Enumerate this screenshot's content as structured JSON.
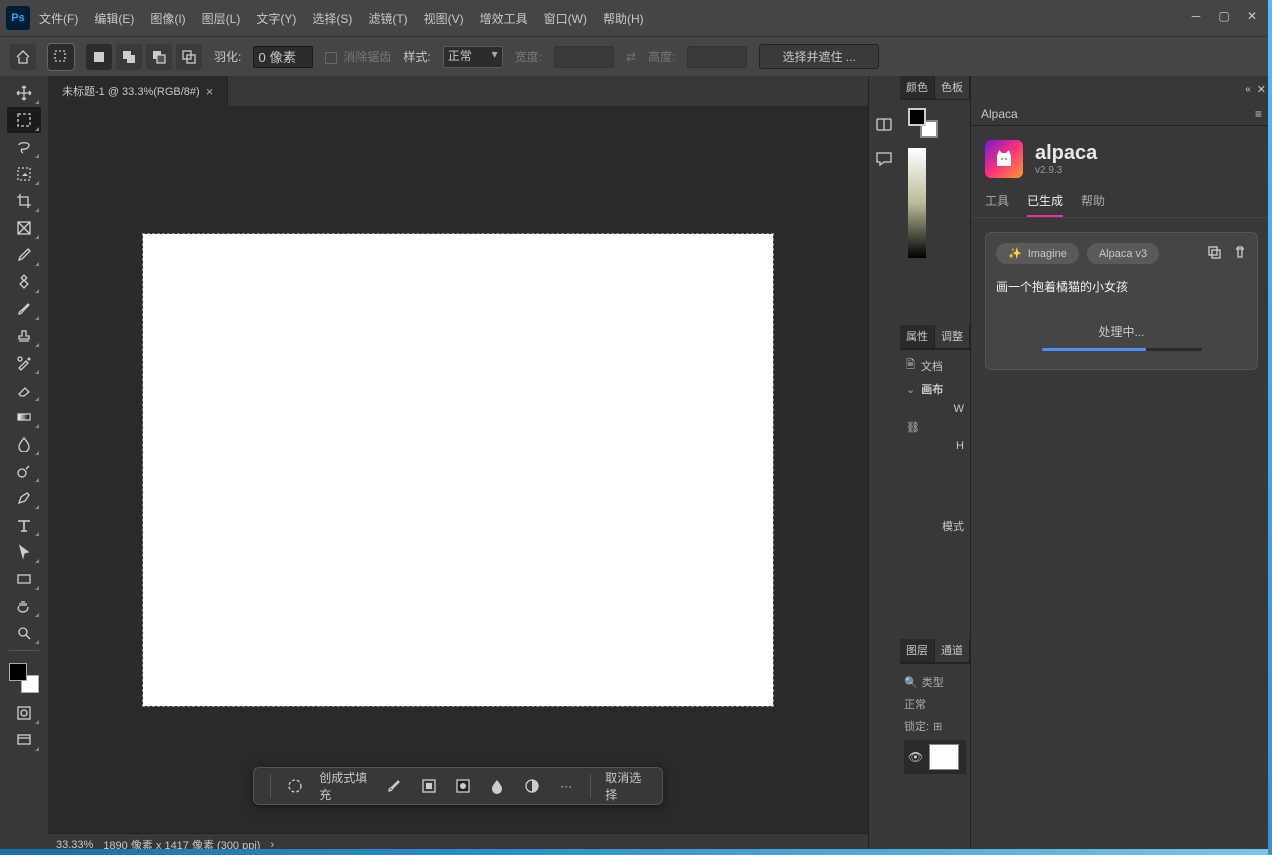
{
  "menu": {
    "items": [
      "文件(F)",
      "编辑(E)",
      "图像(I)",
      "图层(L)",
      "文字(Y)",
      "选择(S)",
      "滤镜(T)",
      "视图(V)",
      "增效工具",
      "窗口(W)",
      "帮助(H)"
    ]
  },
  "options": {
    "feather_label": "羽化:",
    "feather_value": "0 像素",
    "anti_alias": "消除锯齿",
    "style_label": "样式:",
    "style_value": "正常",
    "width_label": "宽度:",
    "width_value": "",
    "height_label": "高度:",
    "height_value": "",
    "select_mask": "选择并遮住 ..."
  },
  "doc": {
    "tab_title": "未标题-1 @ 33.3%(RGB/8#)",
    "zoom": "33.33%",
    "dimensions": "1890 像素 x 1417 像素 (300 ppi)"
  },
  "context_bar": {
    "generate_fill": "创成式填充",
    "cancel_select": "取消选择"
  },
  "panels": {
    "color": "颜色",
    "swatches_tab": "色板",
    "properties": "属性",
    "adjust": "调整",
    "document_row": "文档",
    "canvas": "画布",
    "w_label": "W",
    "h_label": "H",
    "mode_label": "模式",
    "layers": "图层",
    "channels": "通道",
    "type_search": "类型",
    "blend_mode": "正常",
    "lock_label": "锁定:"
  },
  "alpaca": {
    "panel_title": "Alpaca",
    "brand": "alpaca",
    "version": "v2.9.3",
    "tabs": {
      "tools": "工具",
      "generated": "已生成",
      "help": "帮助"
    },
    "pill_imagine": "Imagine",
    "pill_model": "Alpaca v3",
    "prompt": "画一个抱着橘猫的小女孩",
    "status": "处理中..."
  },
  "tools": [
    "move",
    "marquee",
    "lasso",
    "magic-wand",
    "crop",
    "frame",
    "eyedropper",
    "heal",
    "brush",
    "stamp",
    "history-brush",
    "eraser",
    "gradient",
    "blur",
    "dodge",
    "pen",
    "type",
    "path-select",
    "rectangle",
    "hand",
    "zoom",
    "edit-toolbar"
  ]
}
